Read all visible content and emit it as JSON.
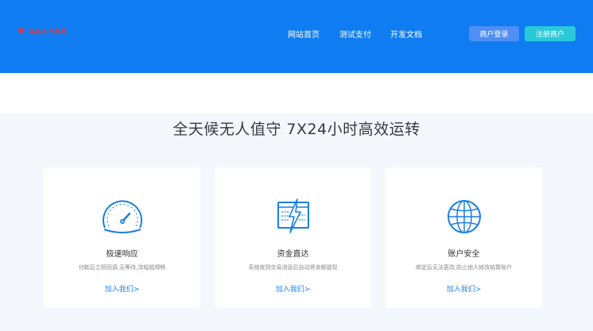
{
  "header": {
    "logo_text": "某某支付系统",
    "nav": [
      "网站首页",
      "测试支付",
      "开发文档"
    ],
    "login_label": "商户登录",
    "register_label": "注册商户"
  },
  "headline": "全天候无人值守 7X24小时高效运转",
  "cards": [
    {
      "icon": "speedometer-icon",
      "title": "极速响应",
      "desc": "付款后立即回调,无等待,流程超顺畅",
      "link": "加入我们>"
    },
    {
      "icon": "lightning-screen-icon",
      "title": "资金直达",
      "desc": "系统收到交易消息后自动将余额提现",
      "link": "加入我们>"
    },
    {
      "icon": "globe-icon",
      "title": "账户安全",
      "desc": "绑定后无法更改,防止他人修改结算账户",
      "link": "加入我们>"
    }
  ],
  "colors": {
    "header_bg": "#0f7df1",
    "login_btn": "#4f8ff5",
    "register_btn": "#2ac9d8",
    "accent": "#1a86ee"
  }
}
